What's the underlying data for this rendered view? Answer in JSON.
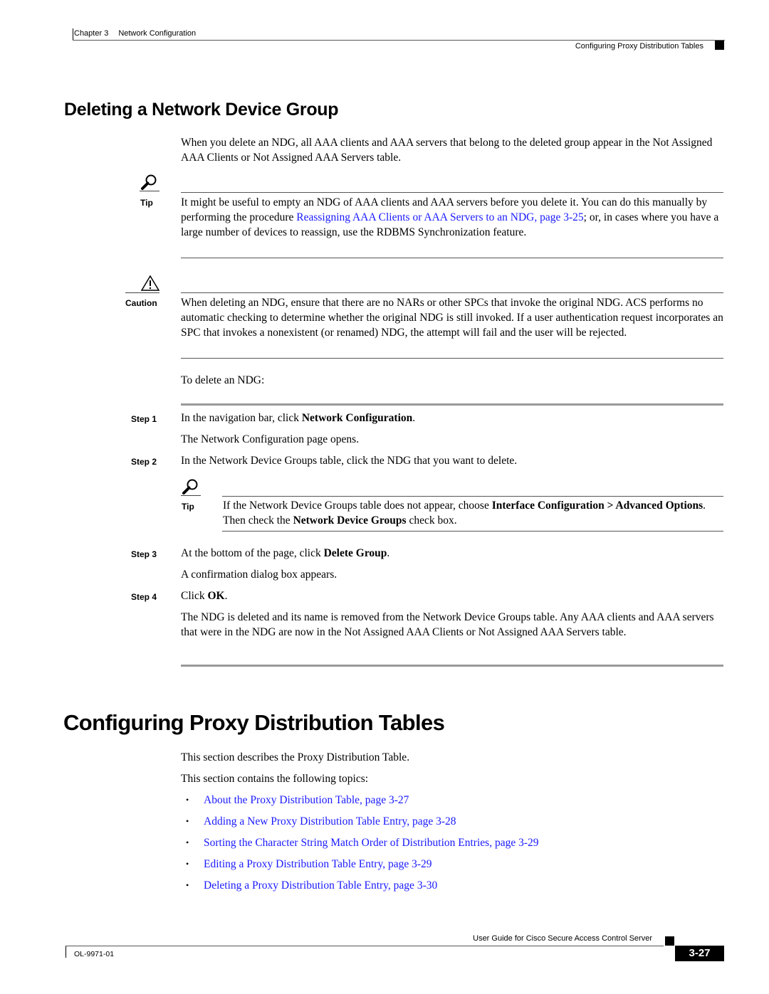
{
  "header": {
    "chapter": "Chapter 3",
    "chapter_title": "Network Configuration",
    "section_title": "Configuring Proxy Distribution Tables"
  },
  "ndg_section": {
    "heading": "Deleting a Network Device Group",
    "intro": "When you delete an NDG, all AAA clients and AAA servers that belong to the deleted group appear in the Not Assigned AAA Clients or Not Assigned AAA Servers table.",
    "tip": {
      "label": "Tip",
      "icon": "magnifier-icon",
      "text_before": "It might be useful to empty an NDG of AAA clients and AAA servers before you delete it. You can do this manually by performing the procedure ",
      "link": "Reassigning AAA Clients or AAA Servers to an NDG, page 3-25",
      "text_after": "; or, in cases where you have a large number of devices to reassign, use the RDBMS Synchronization feature."
    },
    "caution": {
      "label": "Caution",
      "icon": "warning-triangle-icon",
      "text": "When deleting an NDG, ensure that there are no NARs or other SPCs that invoke the original NDG. ACS performs no automatic checking to determine whether the original NDG is still invoked. If a user authentication request incorporates an SPC that invokes a nonexistent (or renamed) NDG, the attempt will fail and the user will be rejected."
    },
    "procedure_intro": "To delete an NDG:",
    "steps": [
      {
        "label": "Step 1",
        "text_before": "In the navigation bar, click ",
        "bold": "Network Configuration",
        "text_after": ".",
        "result": "The Network Configuration page opens."
      },
      {
        "label": "Step 2",
        "text": "In the Network Device Groups table, click the NDG that you want to delete.",
        "tip": {
          "label": "Tip",
          "icon": "magnifier-icon",
          "t1": "If the Network Device Groups table does not appear, choose ",
          "b1": "Interface Configuration > Advanced Options",
          "t2": ". Then check the ",
          "b2": "Network Device Groups",
          "t3": " check box."
        }
      },
      {
        "label": "Step 3",
        "text_before": "At the bottom of the page, click ",
        "bold": "Delete Group",
        "text_after": ".",
        "result": "A confirmation dialog box appears."
      },
      {
        "label": "Step 4",
        "text_before": "Click ",
        "bold": "OK",
        "text_after": ".",
        "result": "The NDG is deleted and its name is removed from the Network Device Groups table. Any AAA clients and AAA servers that were in the NDG are now in the Not Assigned AAA Clients or Not Assigned AAA Servers table."
      }
    ]
  },
  "pdt_section": {
    "heading": "Configuring Proxy Distribution Tables",
    "intro1": "This section describes the Proxy Distribution Table.",
    "intro2": "This section contains the following topics:",
    "bullet": "•",
    "topics": [
      "About the Proxy Distribution Table, page 3-27",
      "Adding a New Proxy Distribution Table Entry, page 3-28",
      "Sorting the Character String Match Order of Distribution Entries, page 3-29",
      "Editing a Proxy Distribution Table Entry, page 3-29",
      "Deleting a Proxy Distribution Table Entry, page 3-30"
    ]
  },
  "footer": {
    "guide_title": "User Guide for Cisco Secure Access Control Server",
    "doc_number": "OL-9971-01",
    "page_number": "3-27"
  },
  "colors": {
    "link": "#1a1aff",
    "text": "#000000",
    "page_badge_bg": "#000000"
  }
}
